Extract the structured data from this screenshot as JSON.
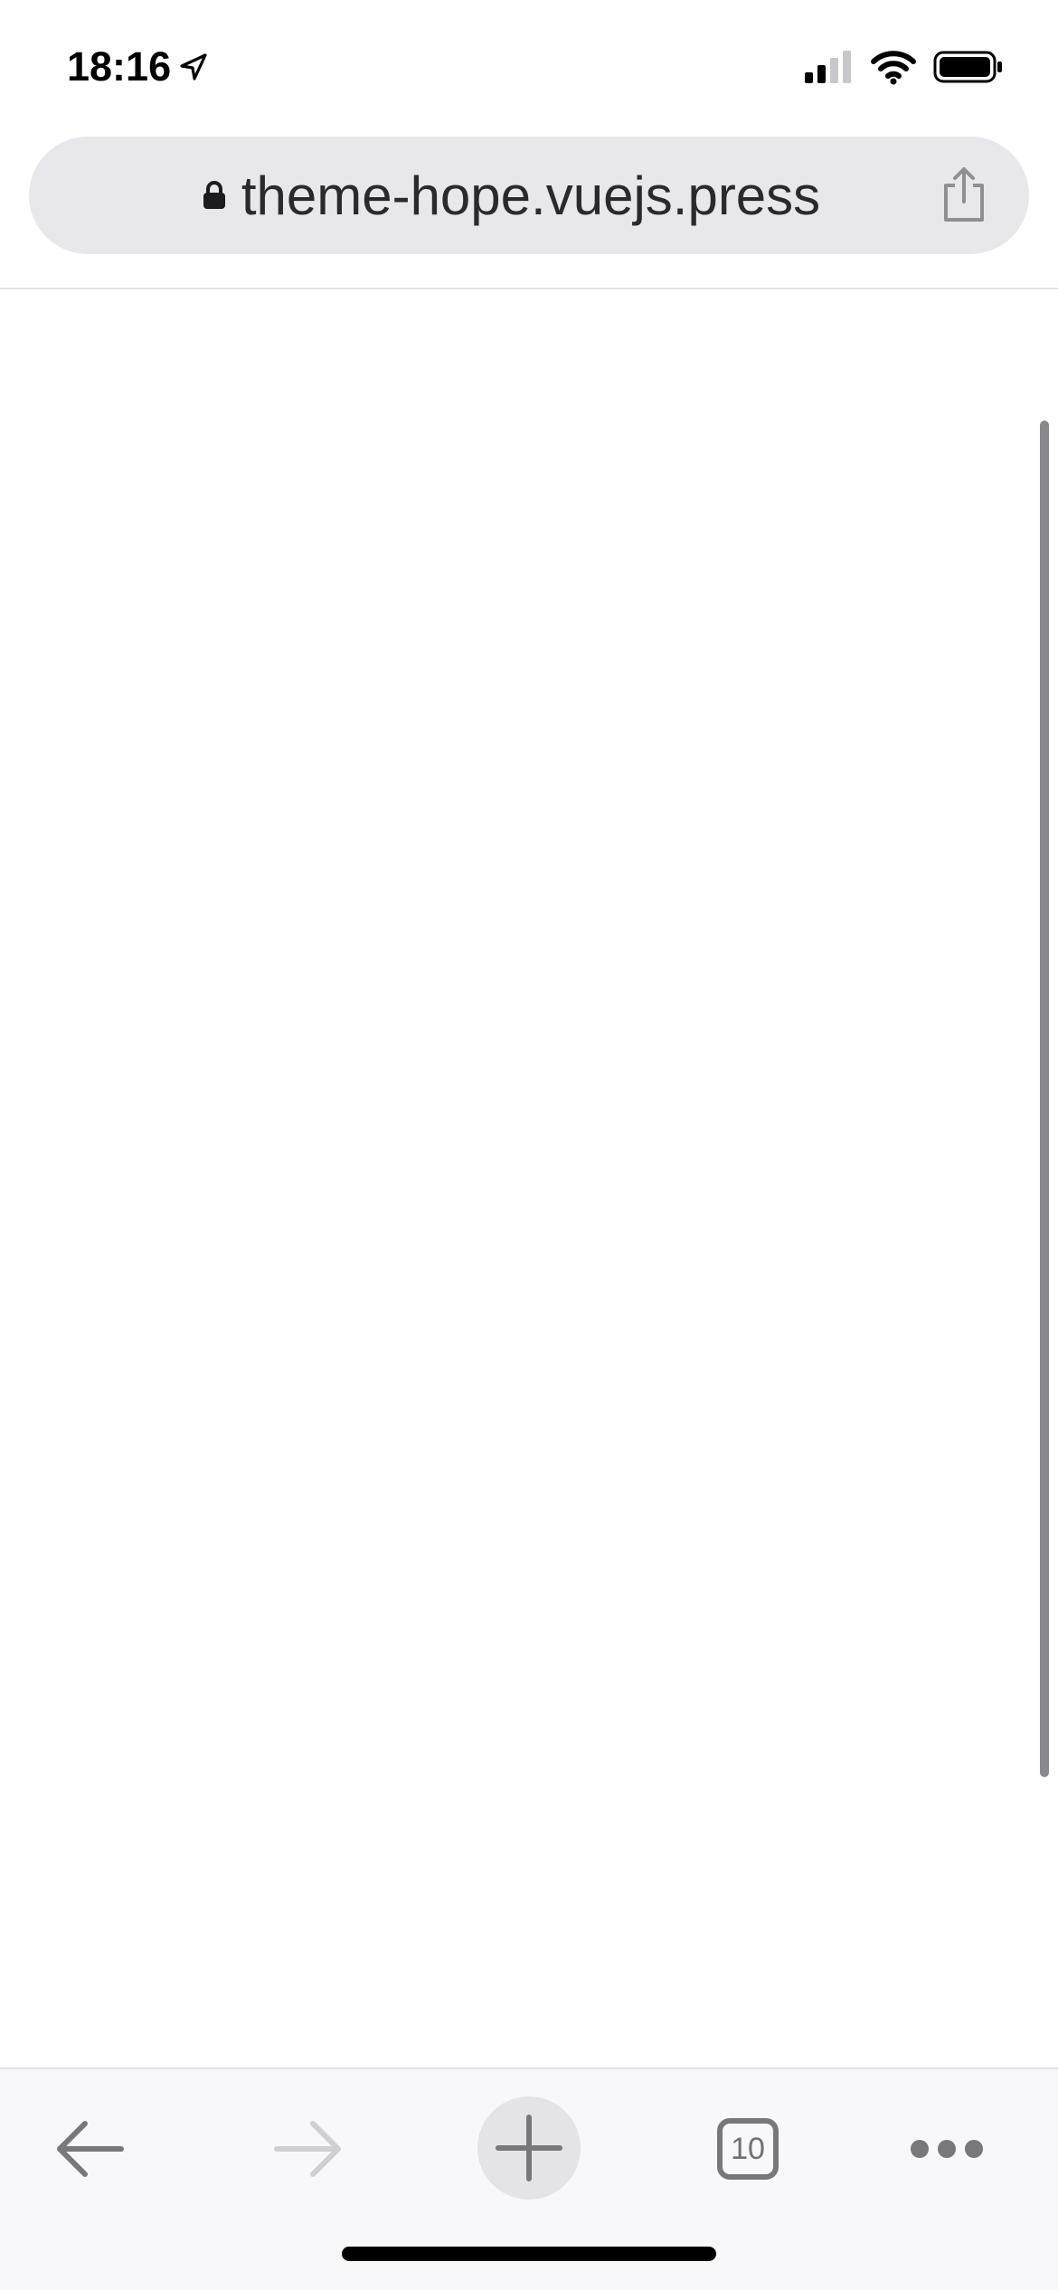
{
  "status_bar": {
    "time": "18:16",
    "icons": [
      "location-arrow-icon",
      "cellular-signal-icon",
      "wifi-icon",
      "battery-icon"
    ]
  },
  "address_bar": {
    "url": "theme-hope.vuejs.press",
    "icons": [
      "lock-icon",
      "share-icon"
    ]
  },
  "bottom_toolbar": {
    "tab_count": "10",
    "buttons": [
      "back-arrow-icon",
      "forward-arrow-icon",
      "new-tab-plus-icon",
      "tab-switcher-icon",
      "more-dots-icon"
    ]
  },
  "colors": {
    "address_bar_bg": "#e8e8ec",
    "toolbar_bg": "#f8f8fa",
    "icon_gray": "#77777c",
    "icon_disabled": "#cfcfd3",
    "text_dark": "#2a2a2e"
  }
}
